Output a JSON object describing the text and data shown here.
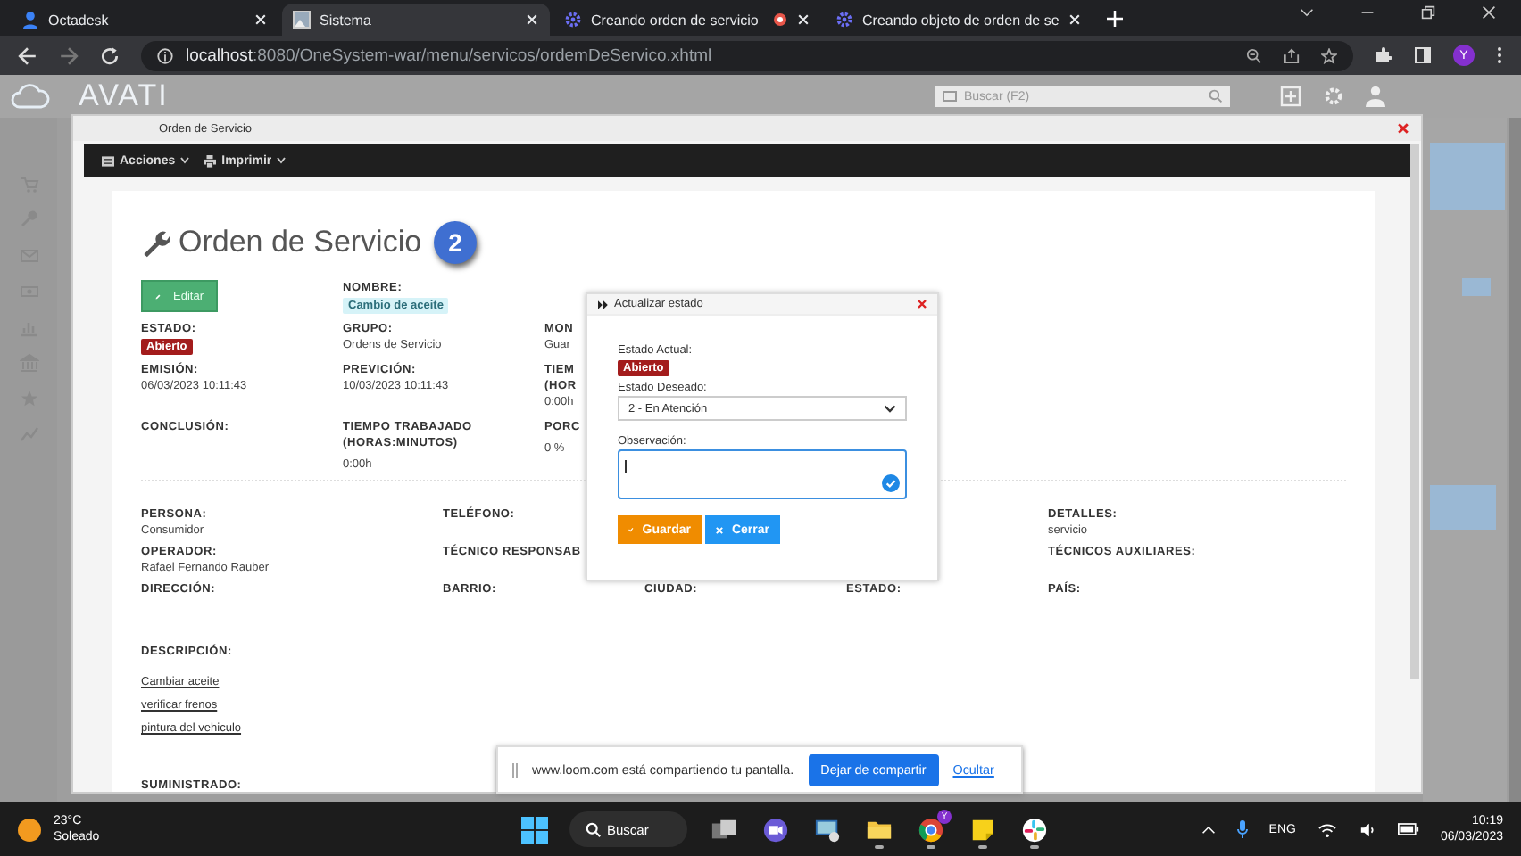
{
  "browser": {
    "tabs": [
      {
        "title": "Octadesk",
        "selected": false
      },
      {
        "title": "Sistema",
        "selected": true
      },
      {
        "title": "Creando orden de servicio",
        "selected": false,
        "recording": true
      },
      {
        "title": "Creando objeto de orden de se",
        "selected": false
      }
    ],
    "address": {
      "host": "localhost",
      "path": ":8080/OneSystem-war/menu/servicos/ordemDeServico.xhtml"
    },
    "profile_initial": "Y"
  },
  "app_header": {
    "logo": "AVATI",
    "search": {
      "placeholder": "Buscar (F2)"
    }
  },
  "window": {
    "title": "Orden de Servicio",
    "toolbar": [
      {
        "label": "Acciones"
      },
      {
        "label": "Imprimir"
      }
    ],
    "heading": "Orden de Servicio",
    "number": "2",
    "sections": [
      {
        "rows": [
          [
            {
              "kind": "button",
              "label": "Editar"
            },
            {
              "kind": "field",
              "label": "NOMBRE:",
              "value": "Cambio de aceite",
              "color": "#d6f3f8"
            }
          ],
          [
            {
              "kind": "field",
              "label": "ESTADO:",
              "value": "Abierto",
              "color": "#a31c1c"
            },
            {
              "kind": "field",
              "label": "GRUPO:",
              "value": "Ordens de Servicio"
            },
            {
              "kind": "field",
              "label": "MON",
              "value": "Guar"
            }
          ],
          [
            {
              "kind": "field",
              "label": "EMISIÓN:",
              "value": "06/03/2023 10:11:43"
            },
            {
              "kind": "field",
              "label": "PREVICIÓN:",
              "value": "10/03/2023 10:11:43"
            },
            {
              "kind": "field",
              "label": "TIEM (HOR",
              "value": "0:00h"
            }
          ],
          [
            {
              "kind": "field",
              "label": "CONCLUSIÓN:"
            },
            {
              "kind": "field",
              "label": "TIEMPO TRABAJADO (HORAS:MINUTOS)",
              "value": "0:00h"
            },
            {
              "kind": "field",
              "label": "PORC",
              "value": "0 %"
            }
          ]
        ]
      },
      {
        "rows": [
          [
            {
              "kind": "field",
              "label": "PERSONA:",
              "value": "Consumidor"
            },
            {
              "kind": "field",
              "label": "TELÉFONO:"
            },
            {
              "kind": "field",
              "label": "DETALLES:",
              "value": "servicio"
            }
          ],
          [
            {
              "kind": "field",
              "label": "OPERADOR:",
              "value": "Rafael Fernando Rauber"
            },
            {
              "kind": "field",
              "label": "TÉCNICO RESPONSAB"
            },
            {
              "kind": "field",
              "label": "TÉCNICOS AUXILIARES:"
            }
          ],
          [
            {
              "kind": "field",
              "label": "DIRECCIÓN:"
            },
            {
              "kind": "field",
              "label": "BARRIO:"
            },
            {
              "kind": "field",
              "label": "CIUDAD:"
            },
            {
              "kind": "field",
              "label": "ESTADO:"
            },
            {
              "kind": "field",
              "label": "PAÍS:"
            }
          ]
        ]
      }
    ],
    "description": {
      "label": "DESCRIPCIÓN:",
      "items": [
        "Cambiar aceite",
        "verificar frenos",
        "pintura del vehiculo"
      ]
    },
    "supplied_label": "SUMINISTRADO:"
  },
  "modal": {
    "title": "Actualizar estado",
    "current_label": "Estado Actual:",
    "current_value": "Abierto",
    "desired_label": "Estado Deseado:",
    "desired_value": "2 - En Atención",
    "observation_label": "Observación:",
    "buttons": [
      {
        "label": "Guardar",
        "kind": "save"
      },
      {
        "label": "Cerrar",
        "kind": "close"
      }
    ]
  },
  "share_bar": {
    "message": "www.loom.com está compartiendo tu pantalla.",
    "stop_button": "Dejar de compartir",
    "hide_link": "Ocultar"
  },
  "taskbar": {
    "weather": {
      "temp": "23°C",
      "condition": "Soleado"
    },
    "search_label": "Buscar",
    "apps": [
      {
        "kind": "task-view",
        "running": false
      },
      {
        "kind": "video",
        "running": false
      },
      {
        "kind": "remote",
        "running": false
      },
      {
        "kind": "folder",
        "running": true
      },
      {
        "kind": "browser",
        "running": true,
        "badge": "Y"
      },
      {
        "kind": "notes",
        "running": true
      },
      {
        "kind": "pinwheel",
        "running": true
      }
    ],
    "language": "ENG",
    "time": "10:19",
    "date": "06/03/2023"
  }
}
